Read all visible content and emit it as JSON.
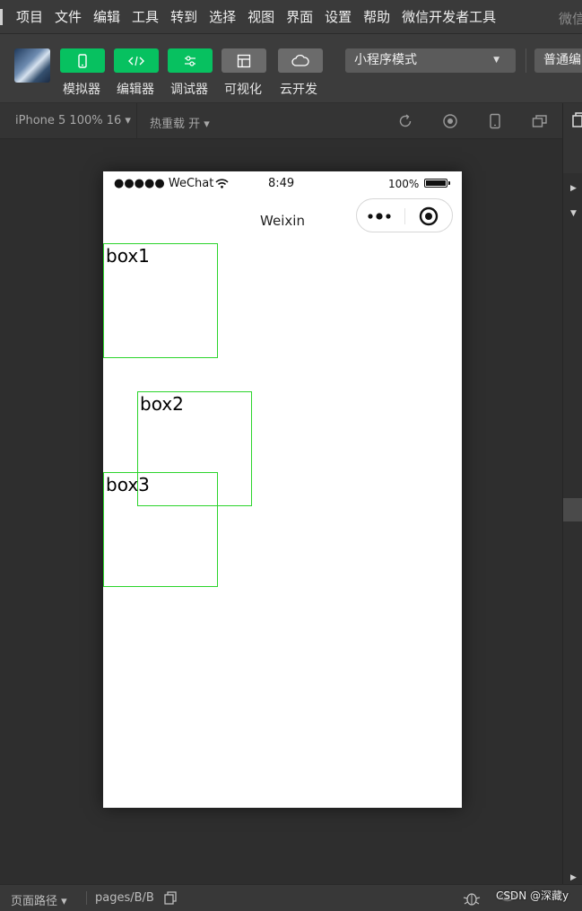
{
  "menubar": {
    "items": [
      "项目",
      "文件",
      "编辑",
      "工具",
      "转到",
      "选择",
      "视图",
      "界面",
      "设置",
      "帮助",
      "微信开发者工具"
    ],
    "right_text": "微信"
  },
  "toolbar": {
    "buttons": [
      {
        "label": "模拟器",
        "icon": "phone-icon",
        "style": "green"
      },
      {
        "label": "编辑器",
        "icon": "code-icon",
        "style": "green"
      },
      {
        "label": "调试器",
        "icon": "debug-icon",
        "style": "green"
      },
      {
        "label": "可视化",
        "icon": "layout-icon",
        "style": "gray"
      },
      {
        "label": "云开发",
        "icon": "cloud-icon",
        "style": "gray"
      }
    ],
    "mode_select": "小程序模式",
    "compile_select": "普通编"
  },
  "simulator": {
    "device": "iPhone 5 100% 16 ▾",
    "hot_reload": "热重载 开 ▾"
  },
  "phone": {
    "status": {
      "carrier": "●●●●● WeChat",
      "time": "8:49",
      "battery": "100%"
    },
    "nav_title": "Weixin",
    "boxes": [
      {
        "label": "box1"
      },
      {
        "label": "box2"
      },
      {
        "label": "box3"
      }
    ]
  },
  "bottombar": {
    "path_label": "页面路径 ▾",
    "path": "pages/B/B"
  },
  "watermark": "CSDN @深藏y",
  "colors": {
    "accent_green": "#07c160",
    "box_border": "#2bd42b"
  }
}
